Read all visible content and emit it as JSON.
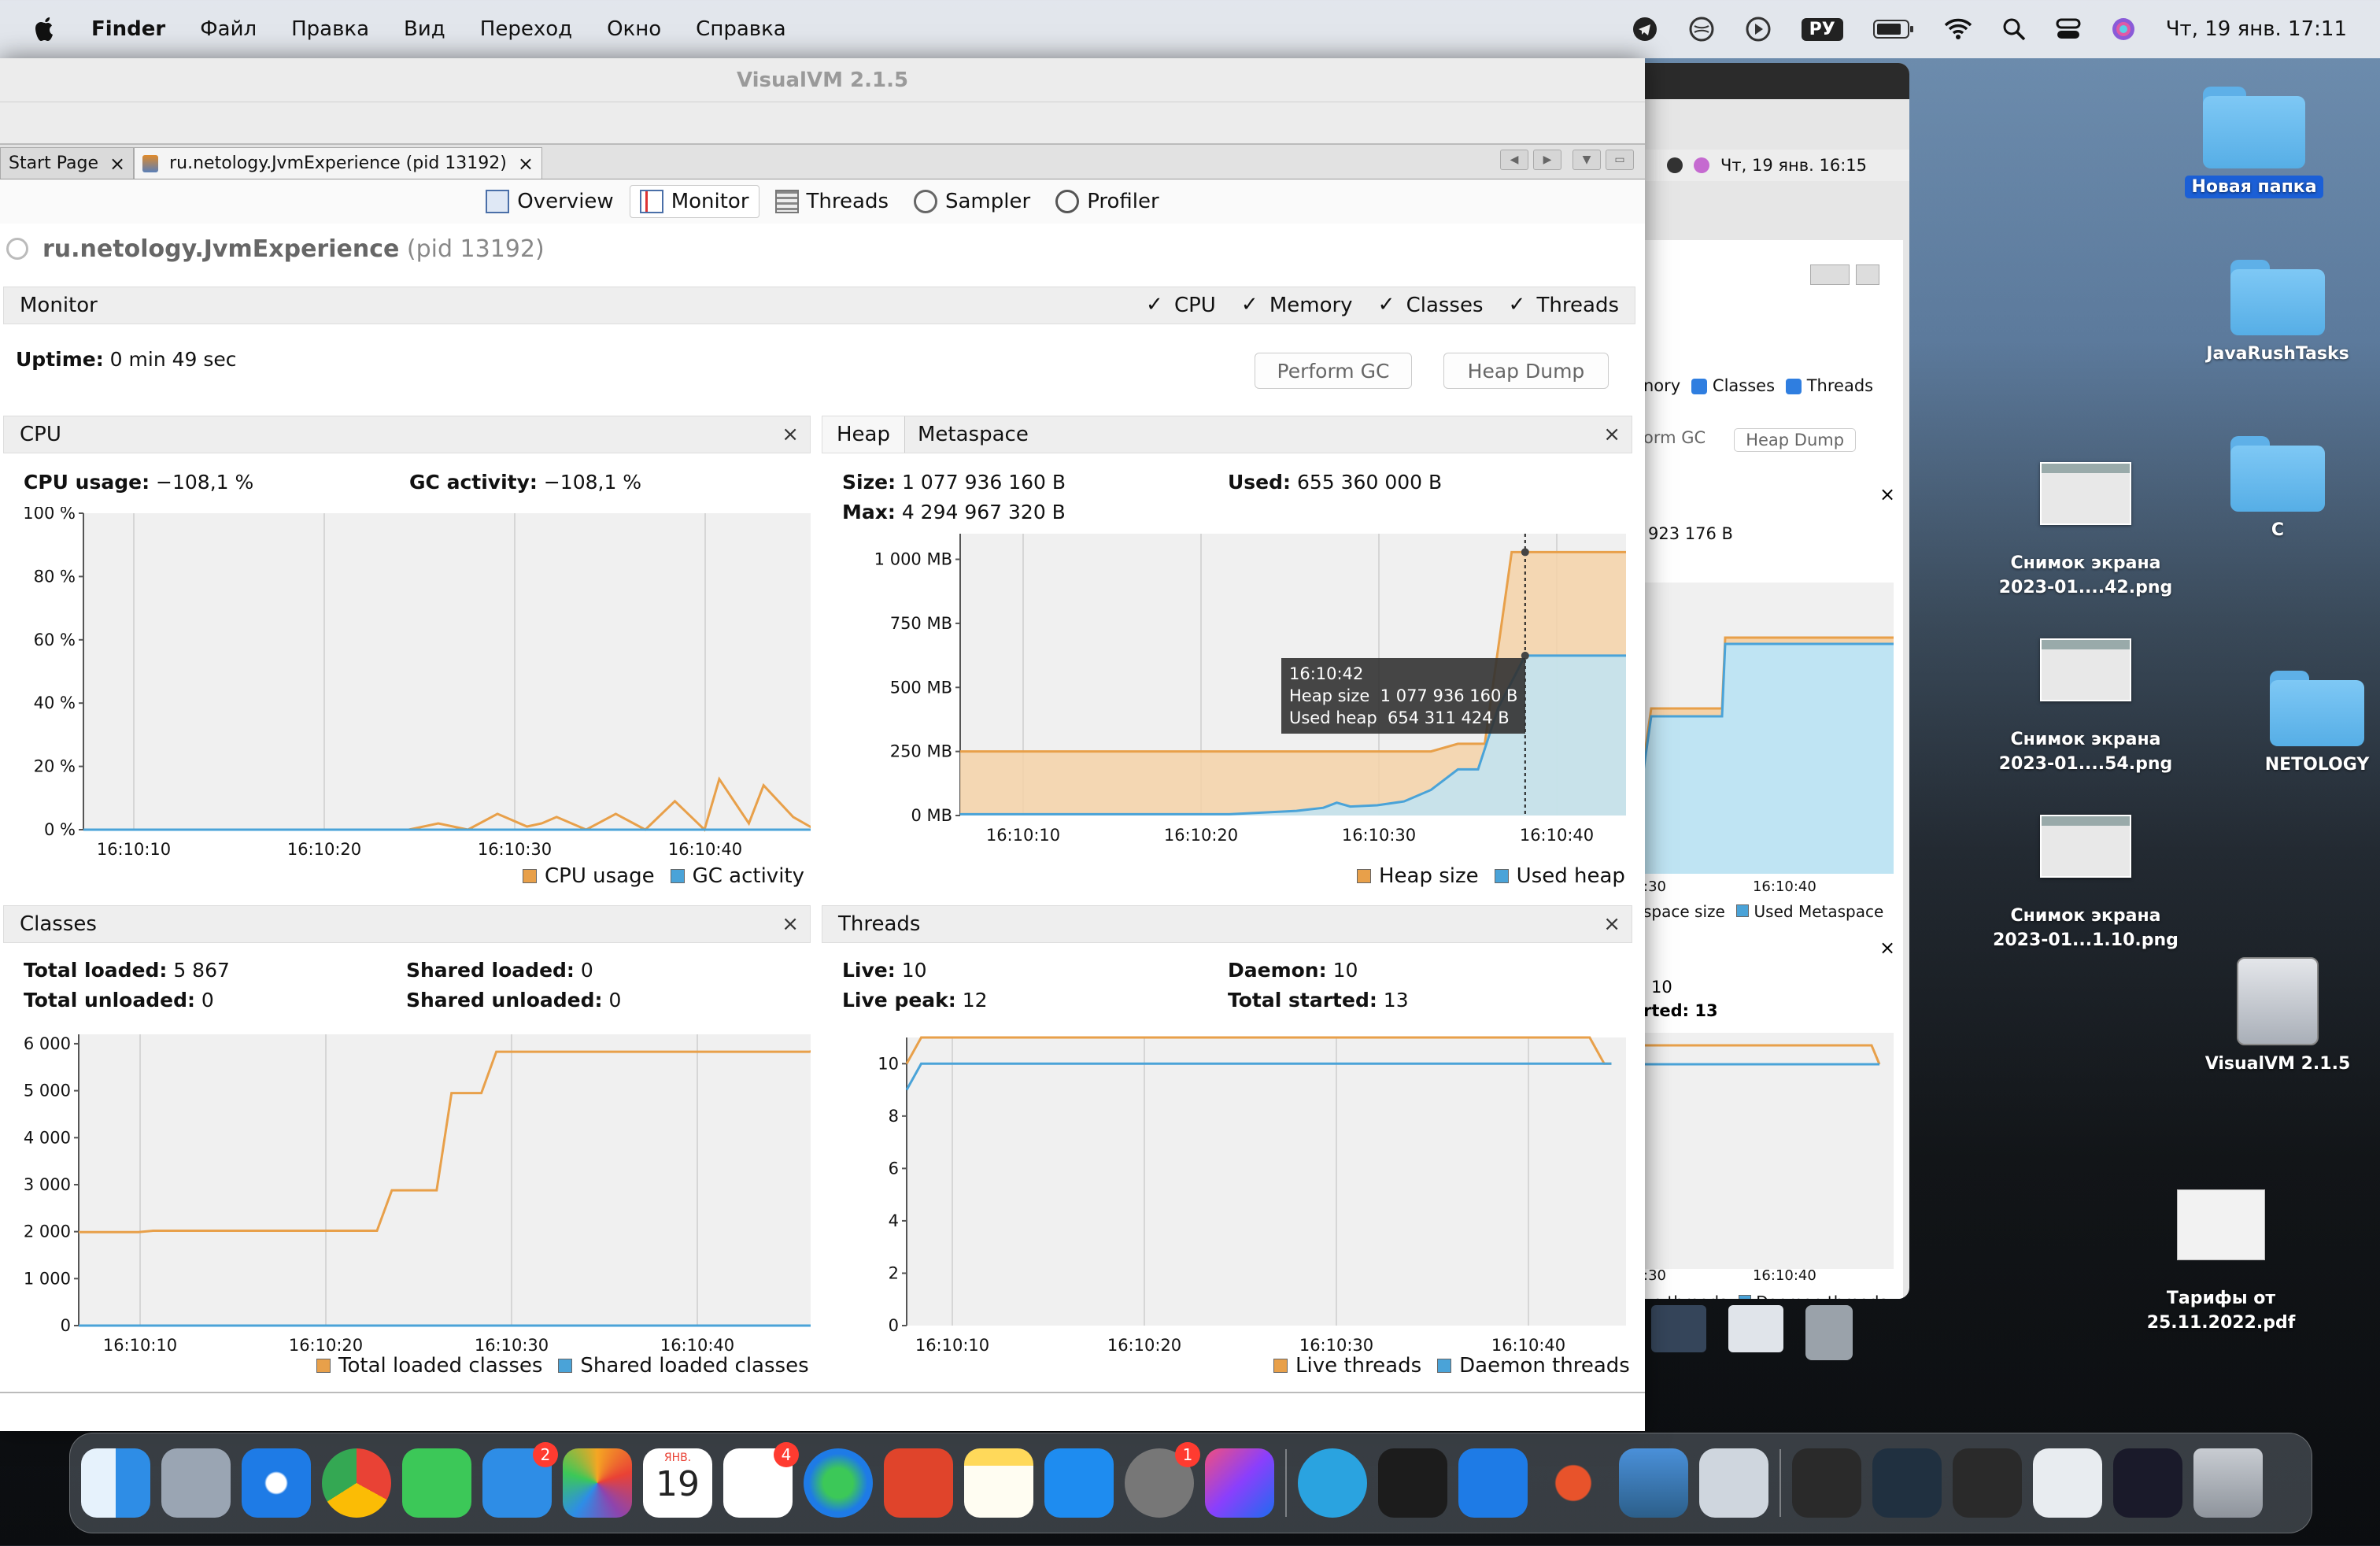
{
  "menubar": {
    "app": "Finder",
    "items": [
      "Файл",
      "Правка",
      "Вид",
      "Переход",
      "Окно",
      "Справка"
    ],
    "lang": "РУ",
    "datetime": "Чт, 19 янв.  17:11"
  },
  "desktop": [
    {
      "label": "Новая папка",
      "kind": "folder"
    },
    {
      "label": "JavaRushTasks",
      "kind": "folder"
    },
    {
      "label": "Снимок экрана\n2023-01....42.png",
      "kind": "image"
    },
    {
      "label": "C",
      "kind": "folder"
    },
    {
      "label": "Снимок экрана\n2023-01....54.png",
      "kind": "image"
    },
    {
      "label": "NETOLOGY",
      "kind": "folder"
    },
    {
      "label": "Снимок экрана\n2023-01...1.10.png",
      "kind": "image"
    },
    {
      "label": "VisualVM 2.1.5",
      "kind": "drive"
    },
    {
      "label": "Тарифы от\n25.11.2022.pdf",
      "kind": "pdf"
    }
  ],
  "backwin": {
    "datetime": "Чт, 19 янв.  16:15",
    "classes": "Classes",
    "threads": "Threads",
    "memory_fragment": "nory",
    "perform_gc": "orm GC",
    "heap_dump": "Heap Dump",
    "size_fragment": "923 176 B",
    "meta_legend": "space size",
    "used_meta": "Used Metaspace",
    "t1": ":30",
    "t2": "16:10:40",
    "live_frag": "10",
    "started_frag": "rted: 13",
    "t3": ":30",
    "t4": "16:10:40",
    "live_threads_frag": "ve threads",
    "daemon_threads": "Daemon threads"
  },
  "window": {
    "title": "VisualVM 2.1.5",
    "doc_tabs": [
      {
        "label": "Start Page",
        "active": false
      },
      {
        "label": "ru.netology.JvmExperience (pid 13192)",
        "active": true
      }
    ],
    "sub_tabs": [
      "Overview",
      "Monitor",
      "Threads",
      "Sampler",
      "Profiler"
    ],
    "app_name": "ru.netology.JvmExperience",
    "app_pid": "(pid 13192)",
    "monitor_label": "Monitor",
    "checks": [
      "CPU",
      "Memory",
      "Classes",
      "Threads"
    ],
    "uptime_label": "Uptime:",
    "uptime_value": "0 min 49 sec",
    "perform_gc": "Perform GC",
    "heap_dump": "Heap Dump",
    "cpu": {
      "title": "CPU",
      "usage_label": "CPU usage:",
      "usage_value": "−108,1 %",
      "gc_label": "GC activity:",
      "gc_value": "−108,1 %",
      "legend": [
        "CPU usage",
        "GC activity"
      ]
    },
    "heap": {
      "tab1": "Heap",
      "tab2": "Metaspace",
      "size_label": "Size:",
      "size_value": "1 077 936 160 B",
      "max_label": "Max:",
      "max_value": "4 294 967 320 B",
      "used_label": "Used:",
      "used_value": "655 360 000 B",
      "legend": [
        "Heap size",
        "Used heap"
      ],
      "tooltip": {
        "time": "16:10:42",
        "l1": "Heap size",
        "v1": "1 077 936 160 B",
        "l2": "Used heap",
        "v2": "654 311 424 B"
      }
    },
    "classes": {
      "title": "Classes",
      "total_loaded_label": "Total loaded:",
      "total_loaded": "5 867",
      "total_unloaded_label": "Total unloaded:",
      "total_unloaded": "0",
      "shared_loaded_label": "Shared loaded:",
      "shared_loaded": "0",
      "shared_unloaded_label": "Shared unloaded:",
      "shared_unloaded": "0",
      "legend": [
        "Total loaded classes",
        "Shared loaded classes"
      ]
    },
    "threads": {
      "title": "Threads",
      "live_label": "Live:",
      "live": "10",
      "peak_label": "Live peak:",
      "peak": "12",
      "daemon_label": "Daemon:",
      "daemon": "10",
      "started_label": "Total started:",
      "started": "13",
      "legend": [
        "Live threads",
        "Daemon threads"
      ]
    }
  },
  "dock": {
    "badges": {
      "mail": "2",
      "reminders": "4",
      "settings": "1"
    },
    "calendar_month": "ЯНВ.",
    "calendar_day": "19"
  },
  "colors": {
    "orange": "#e8a04a",
    "blue": "#4aa3d8",
    "orange_fill": "#f5d2a8",
    "blue_fill": "#bfe4f3"
  },
  "chart_data": [
    {
      "type": "line",
      "title": "CPU",
      "x": [
        "16:10:10",
        "16:10:20",
        "16:10:30",
        "16:10:40"
      ],
      "ylim": [
        0,
        100
      ],
      "yticks": [
        "0 %",
        "20 %",
        "40 %",
        "60 %",
        "80 %",
        "100 %"
      ],
      "series": [
        {
          "name": "CPU usage",
          "points": [
            [
              0,
              0
            ],
            [
              6,
              0
            ],
            [
              10,
              0
            ],
            [
              15,
              0
            ],
            [
              22,
              0
            ],
            [
              24,
              2
            ],
            [
              26,
              0
            ],
            [
              28,
              5
            ],
            [
              30,
              1
            ],
            [
              31,
              2
            ],
            [
              32,
              4
            ],
            [
              34,
              0
            ],
            [
              36,
              5
            ],
            [
              38,
              0
            ],
            [
              40,
              9
            ],
            [
              42,
              0
            ],
            [
              43,
              16
            ],
            [
              45,
              2
            ],
            [
              46,
              14
            ],
            [
              48,
              4
            ],
            [
              49.5,
              0
            ]
          ]
        },
        {
          "name": "GC activity",
          "points": [
            [
              0,
              0
            ],
            [
              49.5,
              0
            ]
          ]
        }
      ]
    },
    {
      "type": "area",
      "title": "Heap",
      "x": [
        "16:10:10",
        "16:10:20",
        "16:10:30",
        "16:10:40"
      ],
      "ylim": [
        0,
        1100
      ],
      "yticks": [
        "0 MB",
        "250 MB",
        "500 MB",
        "750 MB",
        "1 000 MB"
      ],
      "series": [
        {
          "name": "Heap size",
          "points": [
            [
              0,
              250
            ],
            [
              35,
              250
            ],
            [
              37,
              280
            ],
            [
              39,
              280
            ],
            [
              41,
              1028
            ],
            [
              49.5,
              1028
            ]
          ]
        },
        {
          "name": "Used heap",
          "points": [
            [
              0,
              5
            ],
            [
              20,
              5
            ],
            [
              25,
              18
            ],
            [
              27,
              30
            ],
            [
              28,
              50
            ],
            [
              29,
              35
            ],
            [
              31,
              40
            ],
            [
              33,
              55
            ],
            [
              35,
              100
            ],
            [
              37,
              180
            ],
            [
              38.5,
              180
            ],
            [
              40,
              420
            ],
            [
              42,
              624
            ],
            [
              49.5,
              624
            ]
          ]
        }
      ]
    },
    {
      "type": "line",
      "title": "Classes",
      "x": [
        "16:10:10",
        "16:10:20",
        "16:10:30",
        "16:10:40"
      ],
      "ylim": [
        0,
        6200
      ],
      "yticks": [
        "0",
        "1 000",
        "2 000",
        "3 000",
        "4 000",
        "5 000",
        "6 000"
      ],
      "series": [
        {
          "name": "Total loaded classes",
          "points": [
            [
              0,
              1990
            ],
            [
              4,
              1990
            ],
            [
              5,
              2020
            ],
            [
              20,
              2020
            ],
            [
              21,
              2880
            ],
            [
              24,
              2880
            ],
            [
              25,
              4950
            ],
            [
              27,
              4950
            ],
            [
              28,
              5830
            ],
            [
              49,
              5830
            ],
            [
              49.5,
              5867
            ]
          ]
        },
        {
          "name": "Shared loaded classes",
          "points": [
            [
              0,
              0
            ],
            [
              49.5,
              0
            ]
          ]
        }
      ]
    },
    {
      "type": "line",
      "title": "Threads",
      "x": [
        "16:10:10",
        "16:10:20",
        "16:10:30",
        "16:10:40"
      ],
      "ylim": [
        0,
        11
      ],
      "yticks": [
        "0",
        "2",
        "4",
        "6",
        "8",
        "10"
      ],
      "series": [
        {
          "name": "Live threads",
          "points": [
            [
              0,
              10
            ],
            [
              1,
              11
            ],
            [
              47,
              11
            ],
            [
              48,
              10
            ],
            [
              48.5,
              10
            ]
          ]
        },
        {
          "name": "Daemon threads",
          "points": [
            [
              0,
              9
            ],
            [
              1,
              10
            ],
            [
              48.5,
              10
            ]
          ]
        }
      ]
    }
  ]
}
